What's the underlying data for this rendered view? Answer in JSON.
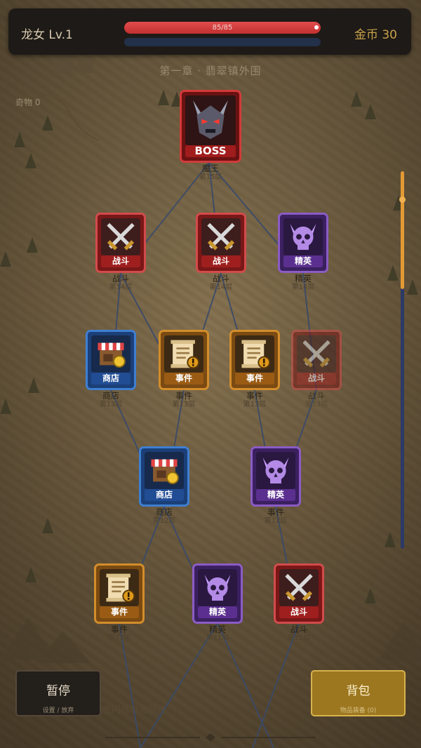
{
  "hud": {
    "player_name": "龙女 Lv.1",
    "hp_text": "85/85",
    "hp_fraction": 1.0,
    "gold": "金币 30"
  },
  "chapter_title": "第一章 · 翡翠镇外围",
  "relic_label": "奇物 0",
  "nodes": [
    {
      "id": "boss",
      "type": "boss",
      "label": "BOSS",
      "caption": "魔王",
      "floor": "第15层",
      "dim": false
    },
    {
      "id": "f14a",
      "type": "battle",
      "label": "战斗",
      "caption": "战斗",
      "floor": "第14层",
      "dim": false
    },
    {
      "id": "f14b",
      "type": "battle",
      "label": "战斗",
      "caption": "战斗",
      "floor": "第14层",
      "dim": false
    },
    {
      "id": "f14c",
      "type": "elite",
      "label": "精英",
      "caption": "精英",
      "floor": "第14层",
      "dim": false
    },
    {
      "id": "f13a",
      "type": "shop",
      "label": "商店",
      "caption": "商店",
      "floor": "第13层",
      "dim": false
    },
    {
      "id": "f13b",
      "type": "event",
      "label": "事件",
      "caption": "事件",
      "floor": "第13层",
      "dim": false
    },
    {
      "id": "f13c",
      "type": "event",
      "label": "事件",
      "caption": "事件",
      "floor": "第13层",
      "dim": false
    },
    {
      "id": "f13d",
      "type": "battle",
      "label": "战斗",
      "caption": "战斗",
      "floor": "第13层",
      "dim": true
    },
    {
      "id": "f12a",
      "type": "shop",
      "label": "商店",
      "caption": "商店",
      "floor": "第12层",
      "dim": false
    },
    {
      "id": "f12b",
      "type": "elite",
      "label": "精英",
      "caption": "事件",
      "floor": "第12层",
      "dim": false
    },
    {
      "id": "f11a",
      "type": "event",
      "label": "事件",
      "caption": "事件",
      "floor": "第11层",
      "dim": false
    },
    {
      "id": "f11b",
      "type": "elite",
      "label": "精英",
      "caption": "精英",
      "floor": "第11层",
      "dim": false
    },
    {
      "id": "f11c",
      "type": "battle",
      "label": "战斗",
      "caption": "战斗",
      "floor": "第11层",
      "dim": false
    }
  ],
  "buttons": {
    "pause_label": "暂停",
    "pause_sub": "设置 / 放弃",
    "bag_label": "背包",
    "bag_sub": "物品装备 (0)"
  },
  "hint": "击闪烁节点前进",
  "colors": {
    "battle": "#d24b4b",
    "elite": "#8b5cc4",
    "shop": "#3f7fd1",
    "event": "#d38d2c",
    "boss": "#d23a3a",
    "gold": "#c8a24a",
    "path": "#3a4a6a"
  }
}
